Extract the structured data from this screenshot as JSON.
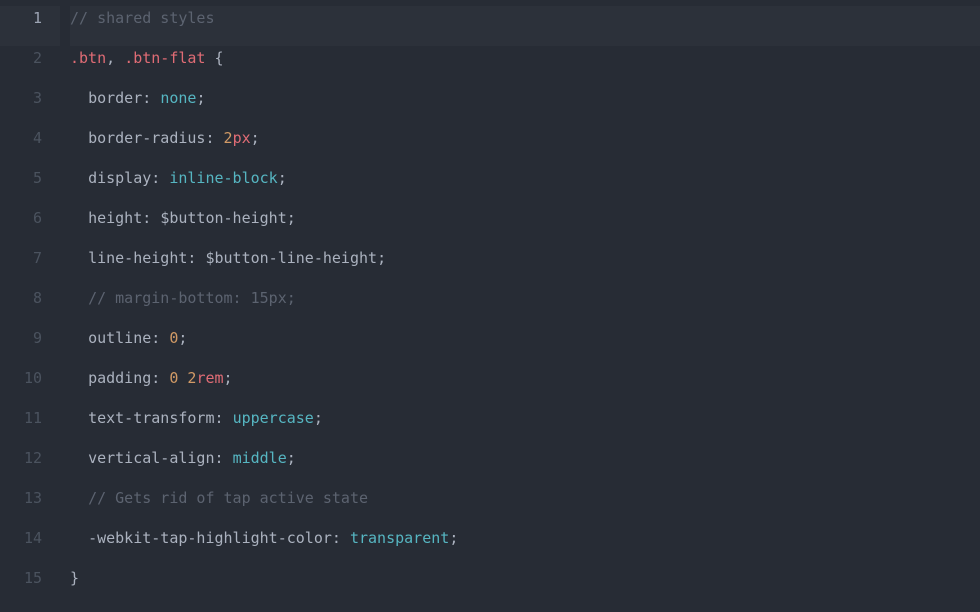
{
  "editor": {
    "active_line": 1,
    "lines": [
      {
        "num": 1,
        "indent": 0,
        "tokens": [
          {
            "t": "comment",
            "s": "// shared styles"
          }
        ]
      },
      {
        "num": 2,
        "indent": 0,
        "tokens": [
          {
            "t": "selector",
            "s": ".btn"
          },
          {
            "t": "punct",
            "s": ", "
          },
          {
            "t": "selector",
            "s": ".btn-flat"
          },
          {
            "t": "punct",
            "s": " {"
          }
        ]
      },
      {
        "num": 3,
        "indent": 1,
        "tokens": [
          {
            "t": "prop",
            "s": "border"
          },
          {
            "t": "colon",
            "s": ": "
          },
          {
            "t": "keyword",
            "s": "none"
          },
          {
            "t": "punct",
            "s": ";"
          }
        ]
      },
      {
        "num": 4,
        "indent": 1,
        "tokens": [
          {
            "t": "prop",
            "s": "border-radius"
          },
          {
            "t": "colon",
            "s": ": "
          },
          {
            "t": "number",
            "s": "2"
          },
          {
            "t": "unit",
            "s": "px"
          },
          {
            "t": "punct",
            "s": ";"
          }
        ]
      },
      {
        "num": 5,
        "indent": 1,
        "tokens": [
          {
            "t": "prop",
            "s": "display"
          },
          {
            "t": "colon",
            "s": ": "
          },
          {
            "t": "keyword",
            "s": "inline-block"
          },
          {
            "t": "punct",
            "s": ";"
          }
        ]
      },
      {
        "num": 6,
        "indent": 1,
        "tokens": [
          {
            "t": "prop",
            "s": "height"
          },
          {
            "t": "colon",
            "s": ": "
          },
          {
            "t": "var",
            "s": "$button-height"
          },
          {
            "t": "punct",
            "s": ";"
          }
        ]
      },
      {
        "num": 7,
        "indent": 1,
        "tokens": [
          {
            "t": "prop",
            "s": "line-height"
          },
          {
            "t": "colon",
            "s": ": "
          },
          {
            "t": "var",
            "s": "$button-line-height"
          },
          {
            "t": "punct",
            "s": ";"
          }
        ]
      },
      {
        "num": 8,
        "indent": 1,
        "tokens": [
          {
            "t": "comment",
            "s": "// margin-bottom: 15px;"
          }
        ]
      },
      {
        "num": 9,
        "indent": 1,
        "tokens": [
          {
            "t": "prop",
            "s": "outline"
          },
          {
            "t": "colon",
            "s": ": "
          },
          {
            "t": "number",
            "s": "0"
          },
          {
            "t": "punct",
            "s": ";"
          }
        ]
      },
      {
        "num": 10,
        "indent": 1,
        "tokens": [
          {
            "t": "prop",
            "s": "padding"
          },
          {
            "t": "colon",
            "s": ": "
          },
          {
            "t": "number",
            "s": "0"
          },
          {
            "t": "plain",
            "s": " "
          },
          {
            "t": "number",
            "s": "2"
          },
          {
            "t": "unit",
            "s": "rem"
          },
          {
            "t": "punct",
            "s": ";"
          }
        ]
      },
      {
        "num": 11,
        "indent": 1,
        "tokens": [
          {
            "t": "prop",
            "s": "text-transform"
          },
          {
            "t": "colon",
            "s": ": "
          },
          {
            "t": "keyword",
            "s": "uppercase"
          },
          {
            "t": "punct",
            "s": ";"
          }
        ]
      },
      {
        "num": 12,
        "indent": 1,
        "tokens": [
          {
            "t": "prop",
            "s": "vertical-align"
          },
          {
            "t": "colon",
            "s": ": "
          },
          {
            "t": "keyword",
            "s": "middle"
          },
          {
            "t": "punct",
            "s": ";"
          }
        ]
      },
      {
        "num": 13,
        "indent": 1,
        "tokens": [
          {
            "t": "comment",
            "s": "// Gets rid of tap active state"
          }
        ]
      },
      {
        "num": 14,
        "indent": 1,
        "tokens": [
          {
            "t": "prop",
            "s": "-webkit-tap-highlight-color"
          },
          {
            "t": "colon",
            "s": ": "
          },
          {
            "t": "keyword",
            "s": "transparent"
          },
          {
            "t": "punct",
            "s": ";"
          }
        ]
      },
      {
        "num": 15,
        "indent": 0,
        "tokens": [
          {
            "t": "punct",
            "s": "}"
          }
        ]
      }
    ]
  },
  "colors": {
    "background": "#272c35",
    "gutter_dim": "#4b535f",
    "gutter_active": "#9da5b4",
    "active_line_bg": "#2c313a",
    "comment": "#5c6370",
    "selector": "#e06c75",
    "punct": "#abb2bf",
    "prop": "#abb2bf",
    "keyword": "#56b6c2",
    "number": "#d19a66",
    "unit": "#e06c75",
    "var": "#abb2bf"
  }
}
